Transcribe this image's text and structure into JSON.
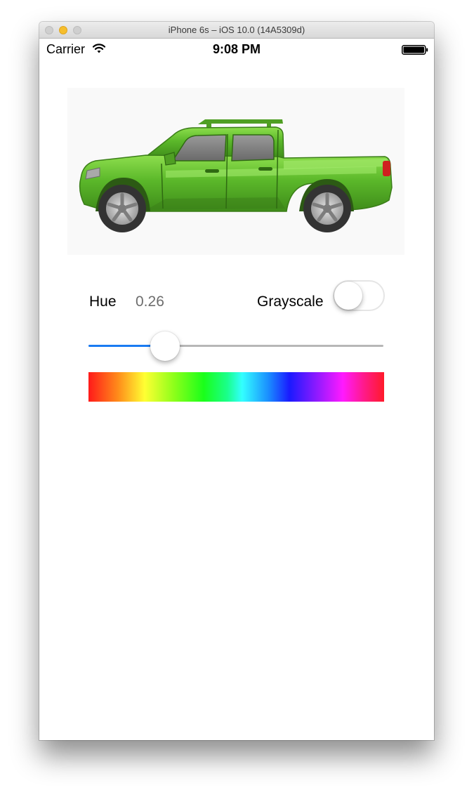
{
  "window": {
    "title": "iPhone 6s – iOS 10.0 (14A5309d)"
  },
  "status_bar": {
    "carrier": "Carrier",
    "time": "9:08 PM",
    "wifi_icon": "wifi-icon",
    "battery_icon": "battery-full-icon"
  },
  "image": {
    "subject": "green pickup truck",
    "body_color": "#5bb82a"
  },
  "controls": {
    "hue_label": "Hue",
    "hue_value": "0.26",
    "hue_fraction": 0.26,
    "grayscale_label": "Grayscale",
    "grayscale_on": false,
    "accent_color": "#1a7bf2"
  },
  "spectrum": {
    "kind": "hue-gradient"
  }
}
